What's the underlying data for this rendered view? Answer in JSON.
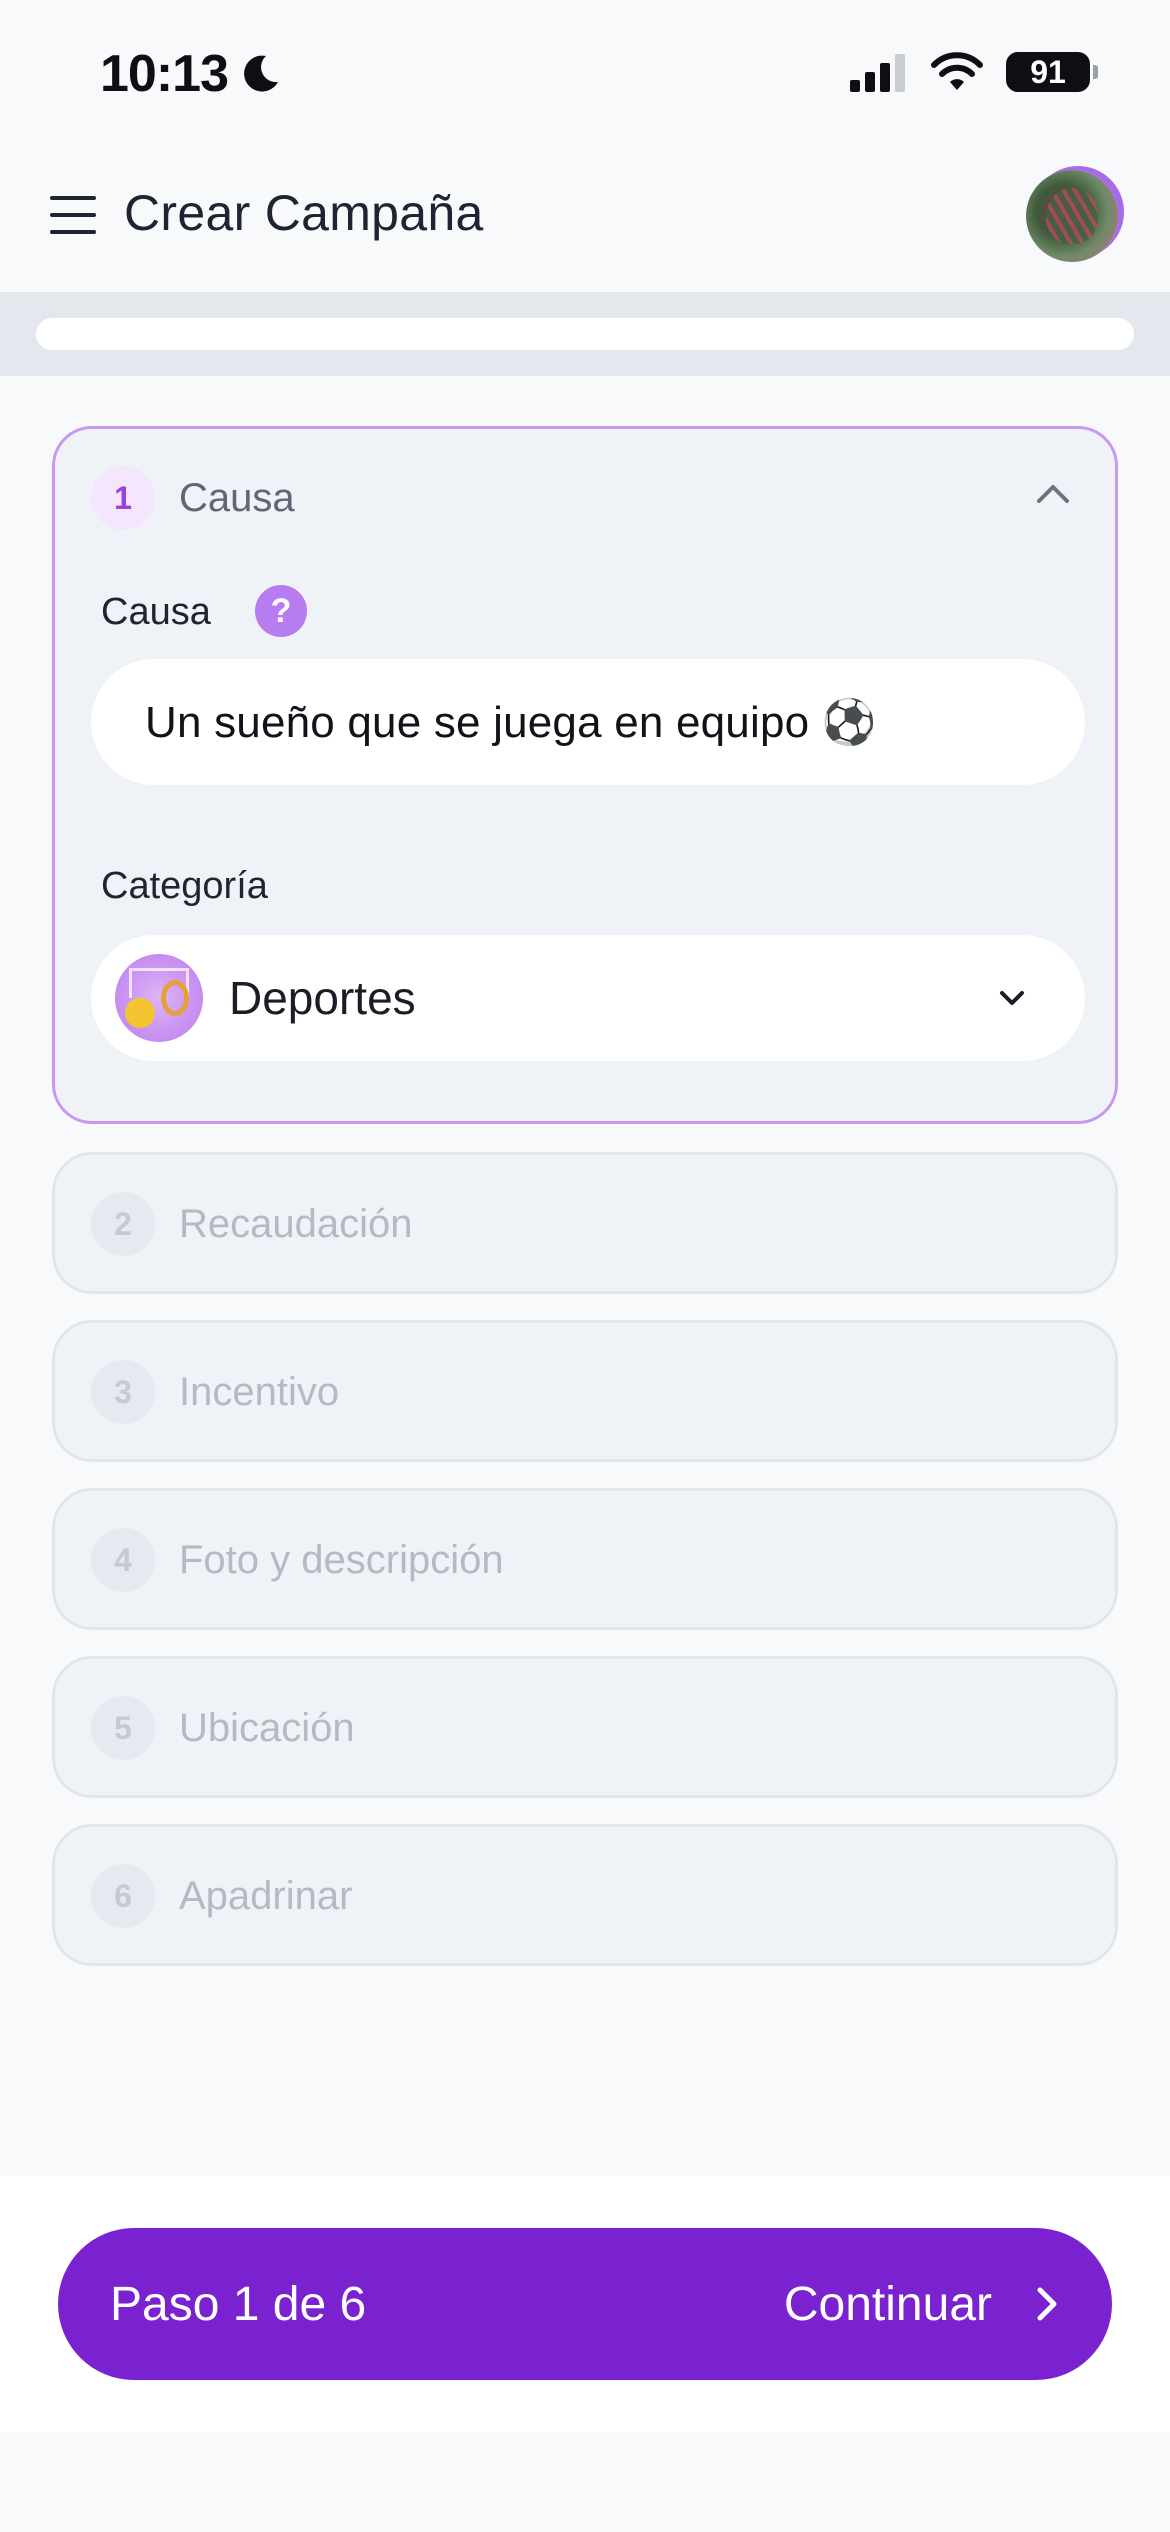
{
  "status_bar": {
    "time": "10:13",
    "battery": "91"
  },
  "header": {
    "title": "Crear Campaña"
  },
  "progress": {
    "fraction": 0.0
  },
  "steps": [
    {
      "number": "1",
      "title": "Causa",
      "expanded": true
    },
    {
      "number": "2",
      "title": "Recaudación",
      "expanded": false
    },
    {
      "number": "3",
      "title": "Incentivo",
      "expanded": false
    },
    {
      "number": "4",
      "title": "Foto y descripción",
      "expanded": false
    },
    {
      "number": "5",
      "title": "Ubicación",
      "expanded": false
    },
    {
      "number": "6",
      "title": "Apadrinar",
      "expanded": false
    }
  ],
  "form": {
    "cause_label": "Causa",
    "help_glyph": "?",
    "cause_value": "Un sueño que se juega en equipo ⚽",
    "category_label": "Categoría",
    "category_value": "Deportes"
  },
  "footer": {
    "step_indicator": "Paso 1 de 6",
    "continue_label": "Continuar"
  },
  "colors": {
    "accent": "#7a22cf",
    "active_border": "#c79af0",
    "help_badge": "#b77cf0"
  }
}
